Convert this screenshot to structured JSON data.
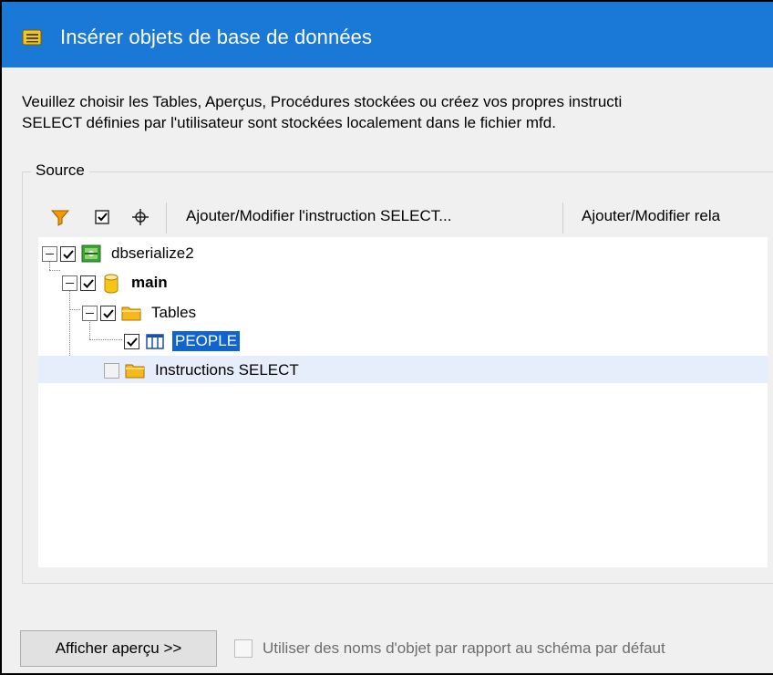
{
  "window": {
    "title": "Insérer objets de base de données",
    "icon": "database-objects-icon"
  },
  "description": {
    "line1": "Veuillez choisir les Tables, Aperçus, Procédures stockées ou créez vos propres instructi",
    "line2": "SELECT définies par l'utilisateur sont stockées localement dans le fichier mfd."
  },
  "source": {
    "label": "Source",
    "toolbar": {
      "filter_icon": "filter-icon",
      "checked_icon": "check-objects-icon",
      "locate_icon": "crosshair-icon",
      "add_select_label": "Ajouter/Modifier l'instruction SELECT...",
      "add_relation_label": "Ajouter/Modifier rela"
    },
    "tree": {
      "nodes": [
        {
          "label": "dbserialize2",
          "checked": true,
          "expanded": true,
          "icon": "sqlite-database-icon"
        },
        {
          "label": "main",
          "checked": true,
          "expanded": true,
          "icon": "schema-cylinder-icon"
        },
        {
          "label": "Tables",
          "checked": true,
          "expanded": true,
          "icon": "folder-icon"
        },
        {
          "label": "PEOPLE",
          "checked": true,
          "selected": true,
          "icon": "table-icon"
        },
        {
          "label": "Instructions SELECT",
          "checked": false,
          "icon": "folder-icon"
        }
      ]
    }
  },
  "footer": {
    "preview_button": "Afficher aperçu >>",
    "default_schema_checkbox": {
      "label": "Utiliser des noms d'objet par rapport au schéma par défaut",
      "checked": false,
      "enabled": false
    }
  },
  "colors": {
    "titlebar": "#1a79d6",
    "selection": "#0f64d2",
    "row_highlight": "#e6eefb",
    "folder": "#f5b81e"
  }
}
